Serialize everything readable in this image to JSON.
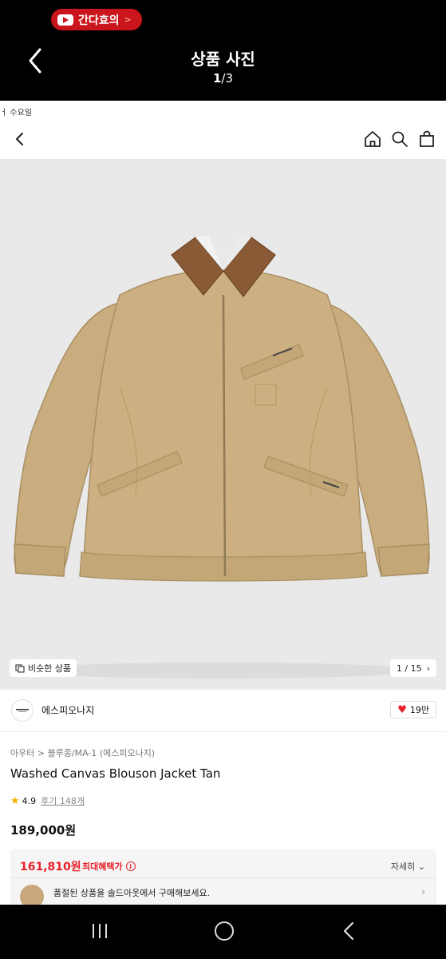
{
  "viewer": {
    "yt_pill_label": "간다효의",
    "yt_pill_arrow": ">",
    "title": "상품 사진",
    "current": "1",
    "separator": "/",
    "total": "3"
  },
  "page": {
    "cut_text": "ㅓ 수요일",
    "icons": [
      "back-chevron-icon",
      "home-icon",
      "search-icon",
      "bag-icon"
    ],
    "image": {
      "similar_label": "비슷한 상품",
      "counter": "1 / 15"
    },
    "brand": {
      "name": "에스피오나지",
      "likes": "19만"
    },
    "breadcrumb": "아우터 > 블루종/MA-1 (에스피오나지)",
    "title": "Washed Canvas Blouson Jacket Tan",
    "rating": "4.9",
    "review": "후기 148개",
    "price": "189,000원",
    "benefit": {
      "price": "161,810원",
      "label": "최대혜택가",
      "detail": "자세히",
      "soldout_text": "품절된 상품을 솔드아웃에서 구매해보세요."
    }
  },
  "colors": {
    "accent": "#e8202a",
    "youtube": "#c9151b",
    "jacket": "#c9ad7e",
    "collar": "#8a5a36"
  }
}
